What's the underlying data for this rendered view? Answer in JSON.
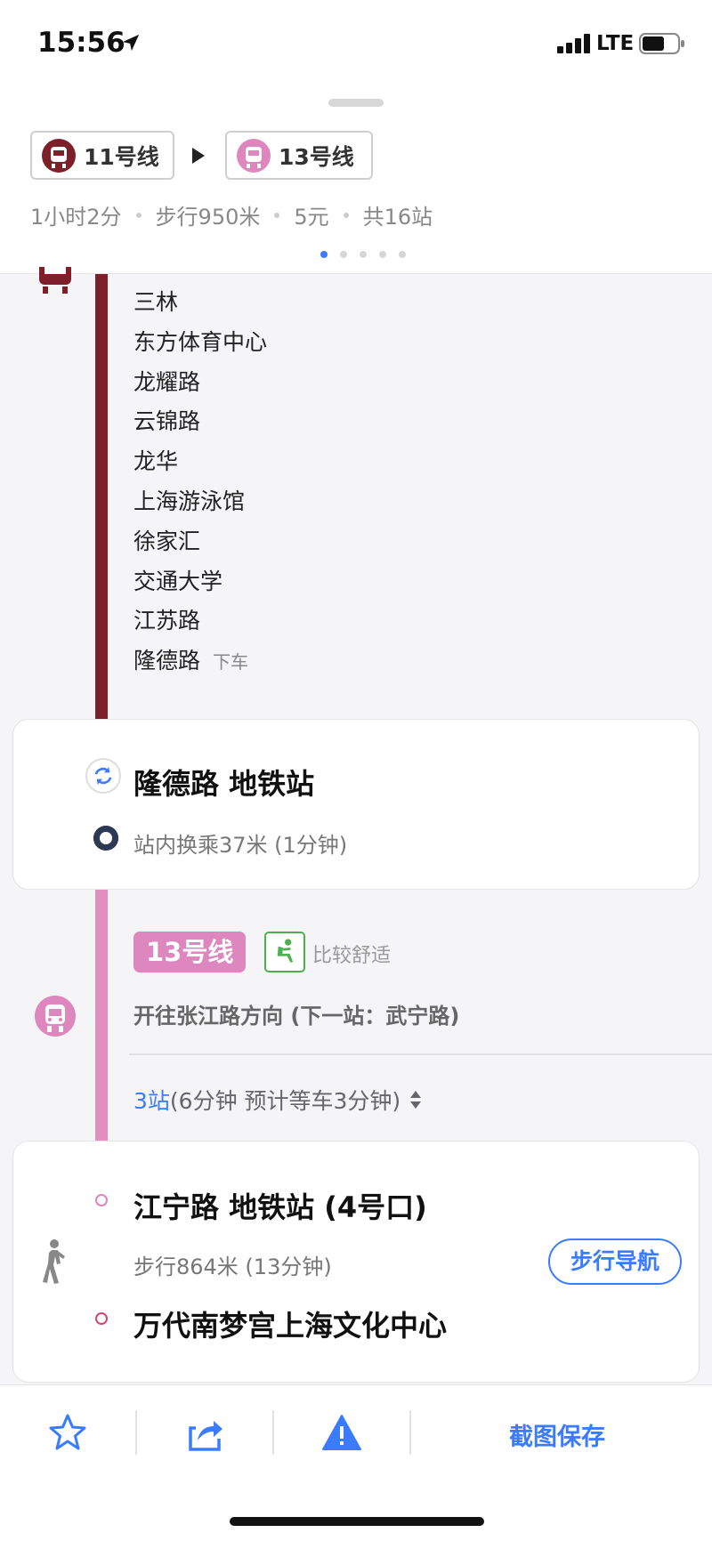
{
  "status_bar": {
    "time": "15:56",
    "network": "LTE"
  },
  "header": {
    "lines": [
      {
        "label": "11号线",
        "color": "#7d2029"
      },
      {
        "label": "13号线",
        "color": "#de86be"
      }
    ],
    "summary": {
      "duration": "1小时2分",
      "walk": "步行950米",
      "fare": "5元",
      "stations": "共16站"
    },
    "page_indicator": {
      "count": 5,
      "active": 1
    }
  },
  "line11": {
    "stations": [
      "三林",
      "东方体育中心",
      "龙耀路",
      "云锦路",
      "龙华",
      "上海游泳馆",
      "徐家汇",
      "交通大学",
      "江苏路",
      "隆德路"
    ],
    "alight_tag": "下车"
  },
  "transfer": {
    "title": "隆德路 地铁站",
    "detail": "站内换乘37米 (1分钟)"
  },
  "line13": {
    "badge": "13号线",
    "comfort": "比较舒适",
    "direction": "开往张江路方向 (下一站：武宁路)",
    "stops_count": "3站",
    "stops_detail": "(6分钟 预计等车3分钟)"
  },
  "walk": {
    "exit_title": "江宁路 地铁站 (4号口)",
    "detail": "步行864米 (13分钟)",
    "nav_button": "步行导航",
    "destination": "万代南梦宫上海文化中心"
  },
  "bottom_bar": {
    "save_label": "截图保存"
  },
  "colors": {
    "line11": "#7d2029",
    "line13": "#e08fbf",
    "accent": "#3b7bff",
    "comfort": "#4caf50"
  },
  "icons": [
    "location-arrow-icon",
    "signal-icon",
    "battery-icon",
    "metro-train-icon",
    "transfer-icon",
    "comfort-seat-icon",
    "sort-icon",
    "walker-icon",
    "star-icon",
    "share-icon",
    "warning-icon"
  ]
}
